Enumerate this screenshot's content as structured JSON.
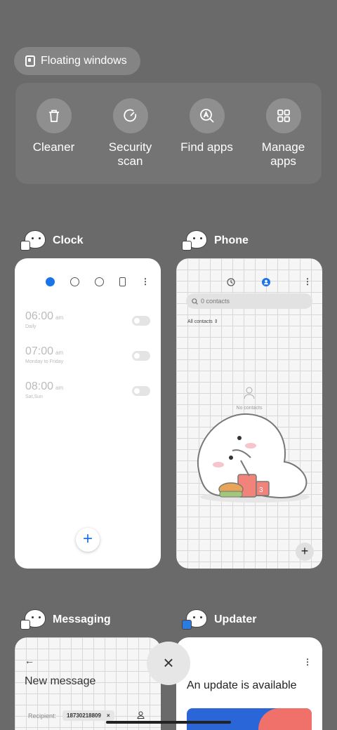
{
  "floating": {
    "label": "Floating windows"
  },
  "tools": [
    {
      "label": "Cleaner",
      "icon": "trash-icon"
    },
    {
      "label": "Security\nscan",
      "icon": "security-scan-icon"
    },
    {
      "label": "Find apps",
      "icon": "find-apps-icon"
    },
    {
      "label": "Manage\napps",
      "icon": "grid-icon"
    }
  ],
  "apps": {
    "clock": {
      "name": "Clock",
      "alarms": [
        {
          "time": "06:00",
          "ampm": "am",
          "repeat": "Daily"
        },
        {
          "time": "07:00",
          "ampm": "am",
          "repeat": "Monday to Friday"
        },
        {
          "time": "08:00",
          "ampm": "am",
          "repeat": "Sat,Sun"
        }
      ],
      "fab": "+"
    },
    "phone": {
      "name": "Phone",
      "search_placeholder": "0 contacts",
      "filter": "All contacts",
      "empty": "No contacts",
      "fab": "+"
    },
    "messaging": {
      "name": "Messaging",
      "title": "New message",
      "recipient_label": "Recipient:",
      "recipient_chip": "18730218809"
    },
    "updater": {
      "name": "Updater",
      "title": "An update is available"
    }
  },
  "close": "×",
  "colors": {
    "accent": "#1a73e8",
    "background": "#6a6a6a"
  }
}
